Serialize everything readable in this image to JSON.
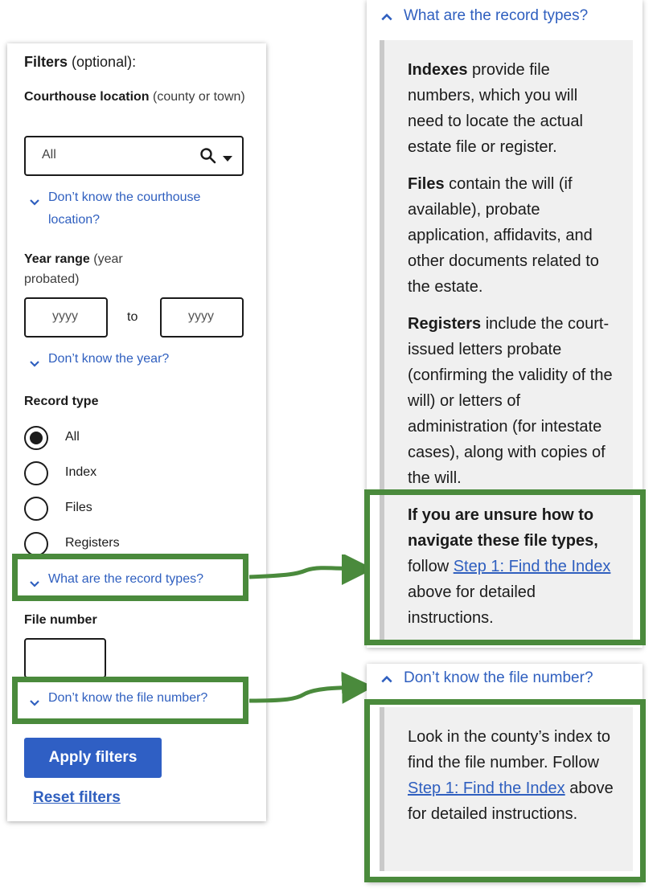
{
  "filters": {
    "heading_bold": "Filters",
    "heading_rest": " (optional):",
    "courthouse": {
      "label_bold": "Courthouse location",
      "label_rest": " (county or town)",
      "value": "All",
      "help_link": "Don’t know the courthouse location?"
    },
    "year_range": {
      "label_bold": "Year range",
      "label_rest": " (year probated)",
      "from_placeholder": "yyyy",
      "to_text": "to",
      "to_placeholder": "yyyy",
      "help_link": "Don’t know the year?"
    },
    "record_type": {
      "label": "Record type",
      "options": [
        "All",
        "Index",
        "Files",
        "Registers"
      ],
      "selected": "All",
      "help_link": "What are the record types?"
    },
    "file_number": {
      "label": "File number",
      "help_link": "Don’t know the file number?"
    },
    "apply_label": "Apply filters",
    "reset_label": "Reset filters"
  },
  "record_types_panel": {
    "title": "What are the record types?",
    "p1_bold": "Indexes",
    "p1_rest": " provide file numbers, which you will need to locate the actual estate file or register.",
    "p2_bold": "Files",
    "p2_rest": " contain the will (if available), probate application, affidavits, and other documents related to the estate.",
    "p3_bold": "Registers",
    "p3_rest": " include the court-issued letters probate (confirming the validity of the will) or letters of administration (for intestate cases), along with copies of the will.",
    "p4_bold": "If you are unsure how to navigate these file types,",
    "p4_pre": " follow ",
    "p4_link": "Step 1: Find the Index",
    "p4_post": " above for detailed instructions."
  },
  "file_number_panel": {
    "title": "Don’t know the file number?",
    "p_pre": "Look in the county’s index to find the file number. Follow ",
    "p_link": "Step 1: Find the Index",
    "p_post": " above for detailed instructions."
  },
  "colors": {
    "link": "#2f5fbf",
    "button": "#2f5fc4",
    "highlight": "#4a8a3c",
    "callout_bg": "#f0f0f0"
  }
}
